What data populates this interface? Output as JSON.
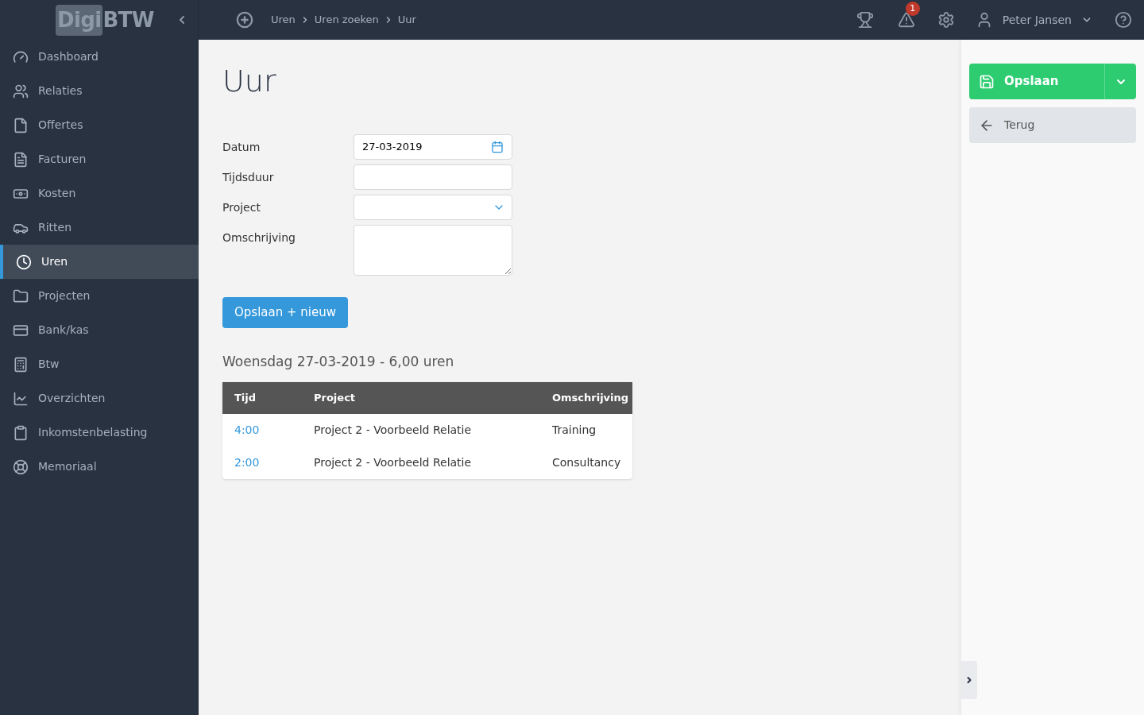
{
  "logo": {
    "part_1": "Digi",
    "part_2": "BTW"
  },
  "breadcrumb": [
    "Uren",
    "Uren zoeken",
    "Uur"
  ],
  "topbar": {
    "alert_count": "1",
    "user": "Peter Jansen"
  },
  "sidebar": {
    "items": [
      {
        "label": "Dashboard",
        "selected": false
      },
      {
        "label": "Relaties",
        "selected": false
      },
      {
        "label": "Offertes",
        "selected": false
      },
      {
        "label": "Facturen",
        "selected": false
      },
      {
        "label": "Kosten",
        "selected": false
      },
      {
        "label": "Ritten",
        "selected": false
      },
      {
        "label": "Uren",
        "selected": true
      },
      {
        "label": "Projecten",
        "selected": false
      },
      {
        "label": "Bank/kas",
        "selected": false
      },
      {
        "label": "Btw",
        "selected": false
      },
      {
        "label": "Overzichten",
        "selected": false
      },
      {
        "label": "Inkomstenbelasting",
        "selected": false
      },
      {
        "label": "Memoriaal",
        "selected": false
      }
    ]
  },
  "page_title": "Uur",
  "form": {
    "fields": [
      {
        "label": "Datum",
        "kind": "date",
        "value": "27-03-2019"
      },
      {
        "label": "Tijdsduur",
        "kind": "text"
      },
      {
        "label": "Project",
        "kind": "select"
      },
      {
        "label": "Omschrijving",
        "kind": "textarea"
      }
    ],
    "submit": "Opslaan + nieuw"
  },
  "day_summary": "Woensdag 27-03-2019 - 6,00 uren",
  "table": {
    "columns": [
      "Tijd",
      "Project",
      "Omschrijving"
    ],
    "rows": [
      {
        "tijd": "4:00",
        "project": "Project 2 - Voorbeeld Relatie",
        "omschrijving": "Training"
      },
      {
        "tijd": "2:00",
        "project": "Project 2 - Voorbeeld Relatie",
        "omschrijving": "Consultancy"
      }
    ]
  },
  "actions": {
    "save": "Opslaan",
    "back": "Terug"
  }
}
